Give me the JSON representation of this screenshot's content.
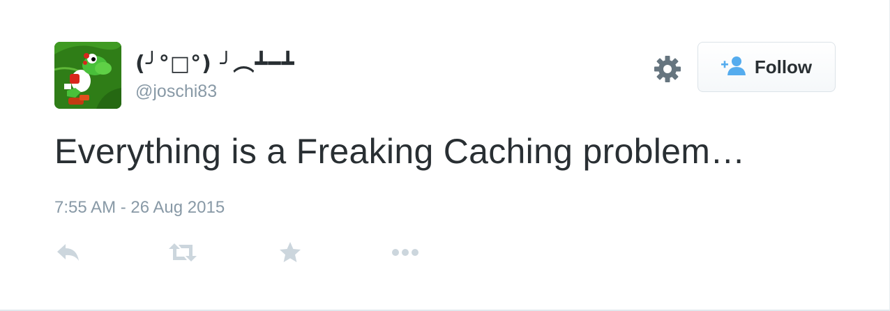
{
  "tweet": {
    "display_name": "(╯°□°) ╯︵┻━┻",
    "handle": "@joschi83",
    "text": "Everything is a Freaking Caching problem…",
    "timestamp": "7:55 AM - 26 Aug 2015"
  },
  "follow_button": {
    "label": "Follow",
    "icon": "add-user-icon"
  },
  "actions": [
    {
      "name": "reply",
      "icon": "reply-icon"
    },
    {
      "name": "retweet",
      "icon": "retweet-icon"
    },
    {
      "name": "favorite",
      "icon": "star-icon"
    },
    {
      "name": "more",
      "icon": "more-icon"
    }
  ],
  "colors": {
    "text_primary": "#292f33",
    "text_secondary": "#8899a6",
    "action_icon": "#ccd6dd",
    "follow_icon": "#55acee",
    "gear_icon": "#66757f"
  }
}
